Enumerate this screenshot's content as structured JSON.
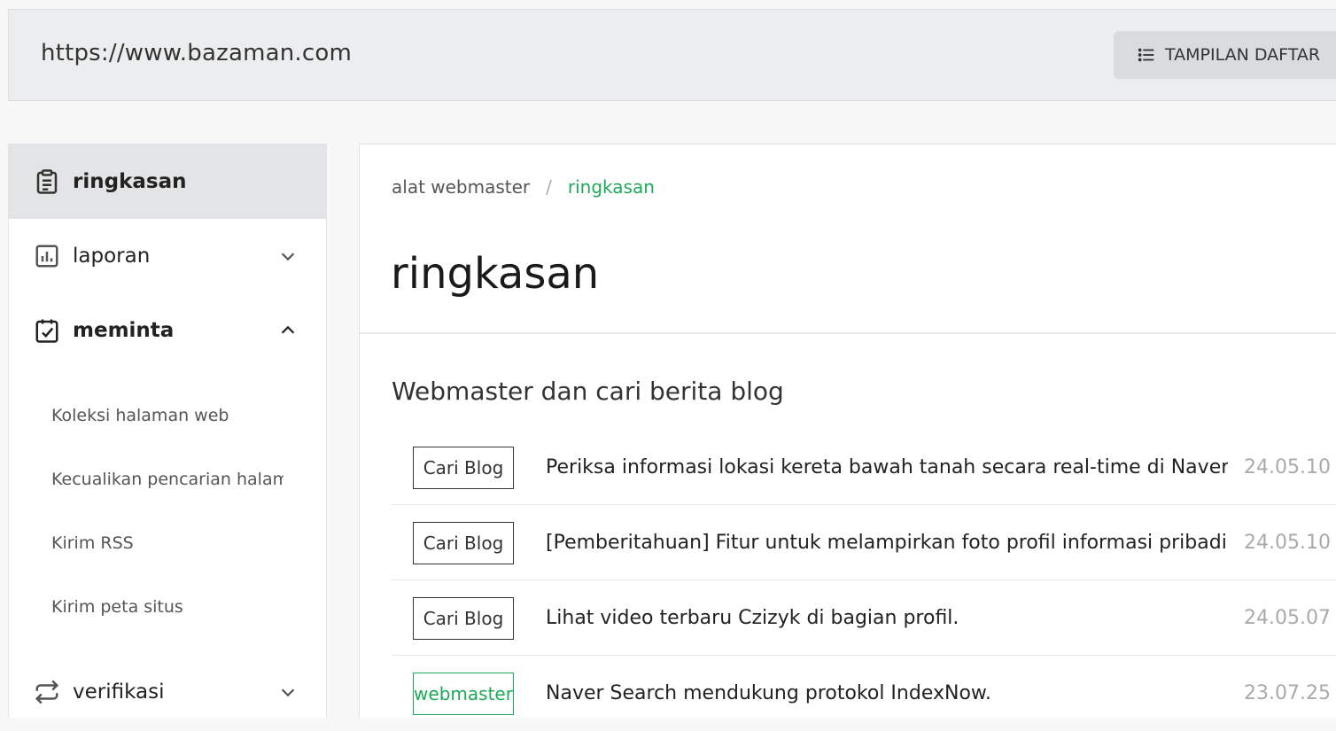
{
  "header": {
    "site_url": "https://www.bazaman.com",
    "list_view_label": "TAMPILAN DAFTAR"
  },
  "sidebar": {
    "items": [
      {
        "label": "ringkasan",
        "icon": "clipboard-icon"
      },
      {
        "label": "laporan",
        "icon": "bar-chart-icon"
      },
      {
        "label": "meminta",
        "icon": "calendar-check-icon"
      },
      {
        "label": "verifikasi",
        "icon": "repeat-icon"
      }
    ],
    "sub_items": [
      "Koleksi halaman web",
      "Kecualikan pencarian halaman",
      "Kirim RSS",
      "Kirim peta situs"
    ]
  },
  "breadcrumb": {
    "root": "alat webmaster",
    "separator": "/",
    "current": "ringkasan"
  },
  "page_title": "ringkasan",
  "section_title": "Webmaster dan cari berita blog",
  "news": [
    {
      "tag": "Cari Blog",
      "title": "Periksa informasi lokasi kereta bawah tanah secara real-time di Naver.",
      "date": "24.05.10"
    },
    {
      "tag": "Cari Blog",
      "title": "[Pemberitahuan] Fitur untuk melampirkan foto profil informasi pribadi telah ditambahkan",
      "date": "24.05.10"
    },
    {
      "tag": "Cari Blog",
      "title": "Lihat video terbaru Czizyk di bagian profil.",
      "date": "24.05.07"
    },
    {
      "tag": "webmaster",
      "title": "Naver Search mendukung protokol IndexNow.",
      "date": "23.07.25"
    }
  ],
  "colors": {
    "accent_green": "#1ea95a",
    "active_bg": "#e3e4e5"
  }
}
